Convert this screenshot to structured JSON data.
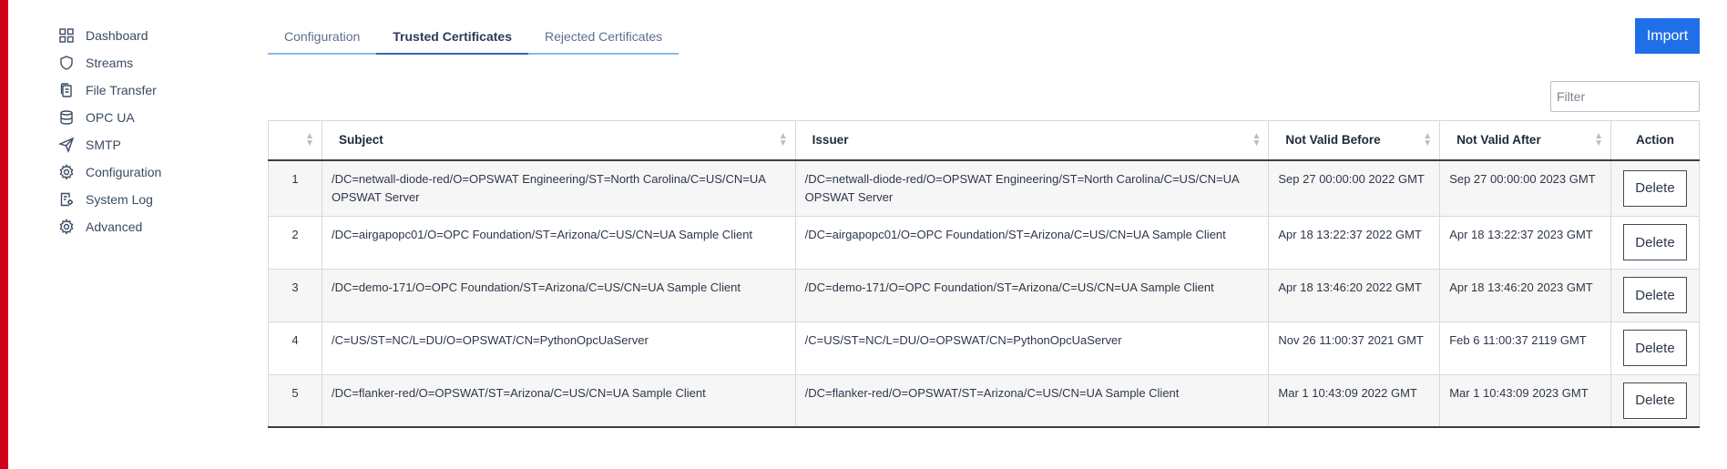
{
  "sidebar": {
    "items": [
      {
        "label": "Dashboard",
        "icon": "grid-icon"
      },
      {
        "label": "Streams",
        "icon": "shield-icon"
      },
      {
        "label": "File Transfer",
        "icon": "files-icon"
      },
      {
        "label": "OPC UA",
        "icon": "database-icon"
      },
      {
        "label": "SMTP",
        "icon": "send-icon"
      },
      {
        "label": "Configuration",
        "icon": "gear-icon"
      },
      {
        "label": "System Log",
        "icon": "log-icon"
      },
      {
        "label": "Advanced",
        "icon": "gear-icon"
      }
    ]
  },
  "tabs": [
    {
      "label": "Configuration",
      "active": false
    },
    {
      "label": "Trusted Certificates",
      "active": true
    },
    {
      "label": "Rejected Certificates",
      "active": false
    }
  ],
  "toolbar": {
    "import_label": "Import"
  },
  "filter": {
    "placeholder": "Filter",
    "value": ""
  },
  "table": {
    "headers": {
      "num": "",
      "subject": "Subject",
      "issuer": "Issuer",
      "not_valid_before": "Not Valid Before",
      "not_valid_after": "Not Valid After",
      "action": "Action"
    },
    "rows": [
      {
        "num": "1",
        "subject": "/DC=netwall-diode-red/O=OPSWAT Engineering/ST=North Carolina/C=US/CN=UA OPSWAT Server",
        "issuer": "/DC=netwall-diode-red/O=OPSWAT Engineering/ST=North Carolina/C=US/CN=UA OPSWAT Server",
        "not_valid_before": "Sep 27 00:00:00 2022 GMT",
        "not_valid_after": "Sep 27 00:00:00 2023 GMT",
        "action": "Delete"
      },
      {
        "num": "2",
        "subject": "/DC=airgapopc01/O=OPC Foundation/ST=Arizona/C=US/CN=UA Sample Client",
        "issuer": "/DC=airgapopc01/O=OPC Foundation/ST=Arizona/C=US/CN=UA Sample Client",
        "not_valid_before": "Apr 18 13:22:37 2022 GMT",
        "not_valid_after": "Apr 18 13:22:37 2023 GMT",
        "action": "Delete"
      },
      {
        "num": "3",
        "subject": "/DC=demo-171/O=OPC Foundation/ST=Arizona/C=US/CN=UA Sample Client",
        "issuer": "/DC=demo-171/O=OPC Foundation/ST=Arizona/C=US/CN=UA Sample Client",
        "not_valid_before": "Apr 18 13:46:20 2022 GMT",
        "not_valid_after": "Apr 18 13:46:20 2023 GMT",
        "action": "Delete"
      },
      {
        "num": "4",
        "subject": "/C=US/ST=NC/L=DU/O=OPSWAT/CN=PythonOpcUaServer",
        "issuer": "/C=US/ST=NC/L=DU/O=OPSWAT/CN=PythonOpcUaServer",
        "not_valid_before": "Nov 26 11:00:37 2021 GMT",
        "not_valid_after": "Feb 6 11:00:37 2119 GMT",
        "action": "Delete"
      },
      {
        "num": "5",
        "subject": "/DC=flanker-red/O=OPSWAT/ST=Arizona/C=US/CN=UA Sample Client",
        "issuer": "/DC=flanker-red/O=OPSWAT/ST=Arizona/C=US/CN=UA Sample Client",
        "not_valid_before": "Mar 1 10:43:09 2022 GMT",
        "not_valid_after": "Mar 1 10:43:09 2023 GMT",
        "action": "Delete"
      }
    ]
  },
  "colors": {
    "brand_red": "#d0011b",
    "primary_blue": "#1f6fe8",
    "tab_underline": "#8db8e4"
  }
}
